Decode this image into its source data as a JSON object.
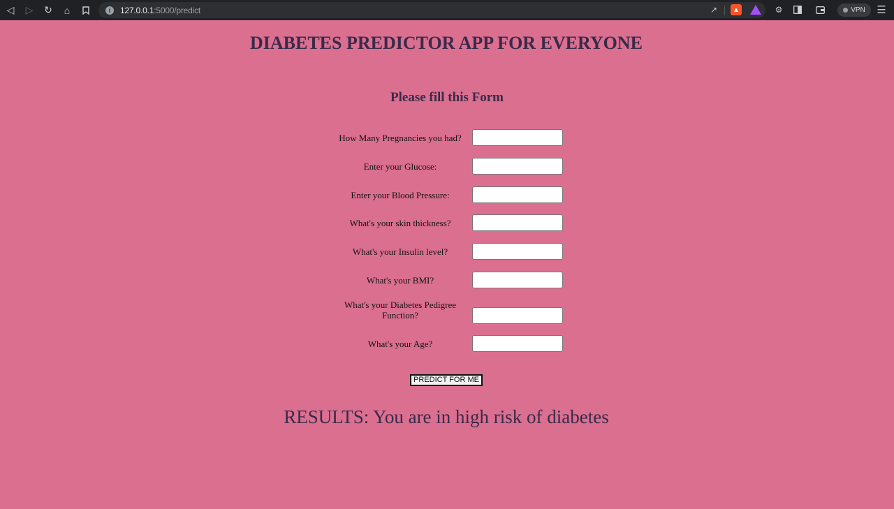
{
  "browser": {
    "url_host": "127.0.0.1",
    "url_path": ":5000/predict",
    "vpn_label": "VPN",
    "icons": [
      "back-icon",
      "forward-icon",
      "reload-icon",
      "home-icon",
      "bookmark-icon",
      "share-icon",
      "brave-shields-icon",
      "brave-rewards-icon",
      "extensions-icon",
      "sidebar-icon",
      "wallet-icon",
      "menu-icon"
    ]
  },
  "page": {
    "title": "DIABETES PREDICTOR APP FOR EVERYONE",
    "form_title": "Please fill this Form",
    "fields": [
      {
        "label": "How Many Pregnancies you had?",
        "value": ""
      },
      {
        "label": "Enter your Glucose:",
        "value": ""
      },
      {
        "label": "Enter your Blood Pressure:",
        "value": ""
      },
      {
        "label": "What's your skin thickness?",
        "value": ""
      },
      {
        "label": "What's your Insulin level?",
        "value": ""
      },
      {
        "label": "What's your BMI?",
        "value": ""
      },
      {
        "label": "What's your Diabetes Pedigree Function?",
        "value": ""
      },
      {
        "label": "What's your Age?",
        "value": ""
      }
    ],
    "submit_label": "PREDICT FOR ME",
    "results": "RESULTS: You are in high risk of diabetes"
  },
  "colors": {
    "background": "#db6f8f",
    "heading": "#3a2a4a"
  }
}
